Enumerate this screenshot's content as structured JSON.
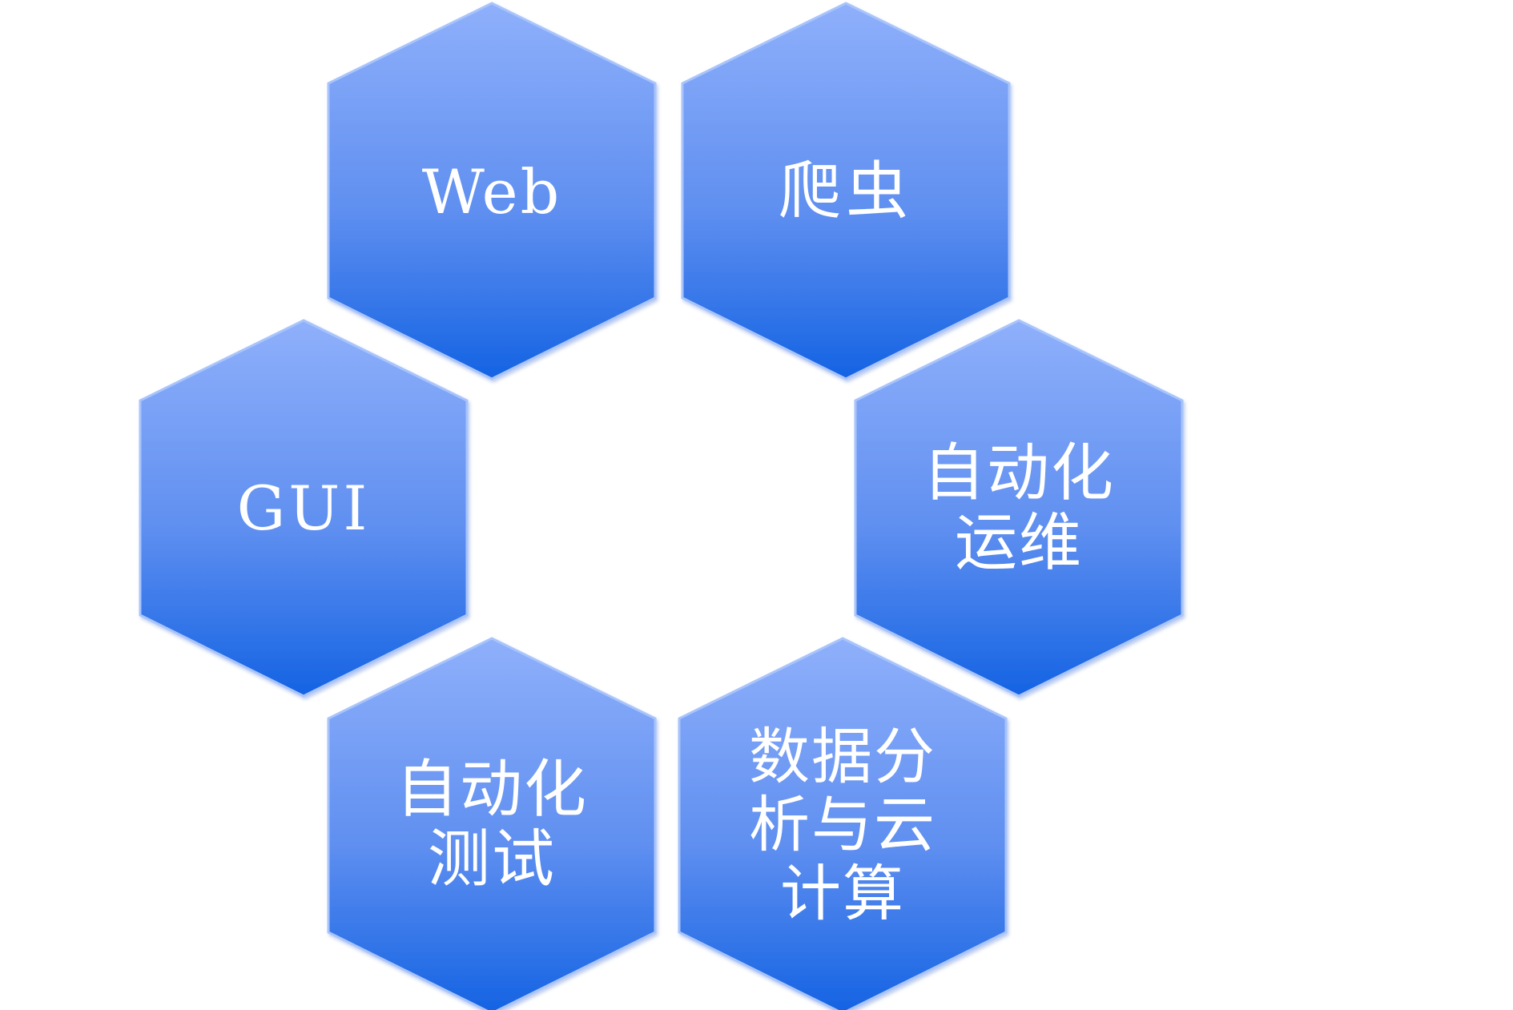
{
  "diagram": {
    "nodes": [
      {
        "id": "web",
        "label": "Web"
      },
      {
        "id": "crawler",
        "label": "爬虫"
      },
      {
        "id": "gui",
        "label": "GUI"
      },
      {
        "id": "ops",
        "label": "自动化\n运维"
      },
      {
        "id": "test",
        "label": "自动化\n测试"
      },
      {
        "id": "data",
        "label": "数据分\n析与云\n计算"
      }
    ]
  },
  "colors": {
    "hex_top": "#8fb0fb",
    "hex_bottom": "#1463e3",
    "hex_edge": "#a9c4fb",
    "label": "#ffffff"
  }
}
